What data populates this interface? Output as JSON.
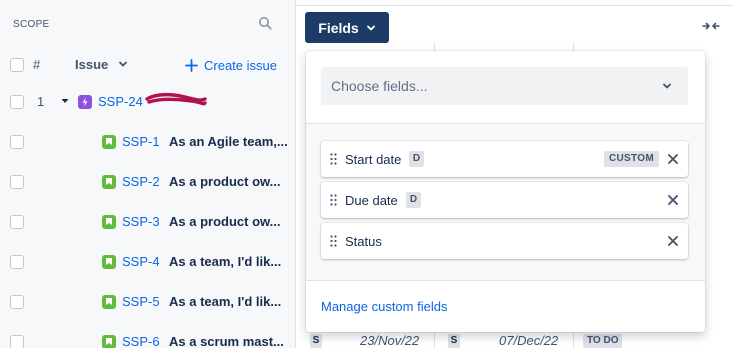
{
  "scope": {
    "label": "SCOPE",
    "header": {
      "hash": "#",
      "issue_label": "Issue",
      "create_label": "Create issue"
    },
    "rows": [
      {
        "num": "1",
        "key": "SSP-24",
        "summary": ""
      },
      {
        "key": "SSP-1",
        "summary": "As an Agile team,..."
      },
      {
        "key": "SSP-2",
        "summary": "As a product ow..."
      },
      {
        "key": "SSP-3",
        "summary": "As a product ow..."
      },
      {
        "key": "SSP-4",
        "summary": "As a team, I'd lik..."
      },
      {
        "key": "SSP-5",
        "summary": "As a team, I'd lik..."
      },
      {
        "key": "SSP-6",
        "summary": "As a scrum mast..."
      }
    ]
  },
  "timeline_row": {
    "start_badge": "S",
    "start_date": "23/Nov/22",
    "due_badge": "S",
    "due_date": "07/Dec/22",
    "status": "TO DO"
  },
  "fields_button": {
    "label": "Fields"
  },
  "fields_panel": {
    "chooser_placeholder": "Choose fields...",
    "items": [
      {
        "name": "Start date",
        "type_badge": "D",
        "tag": "CUSTOM"
      },
      {
        "name": "Due date",
        "type_badge": "D"
      },
      {
        "name": "Status"
      }
    ],
    "manage_link": "Manage custom fields"
  },
  "colors": {
    "accent": "#0c66e4",
    "fields_button_bg": "#1e3a66",
    "epic": "#904ee2",
    "story": "#63ba3c"
  }
}
